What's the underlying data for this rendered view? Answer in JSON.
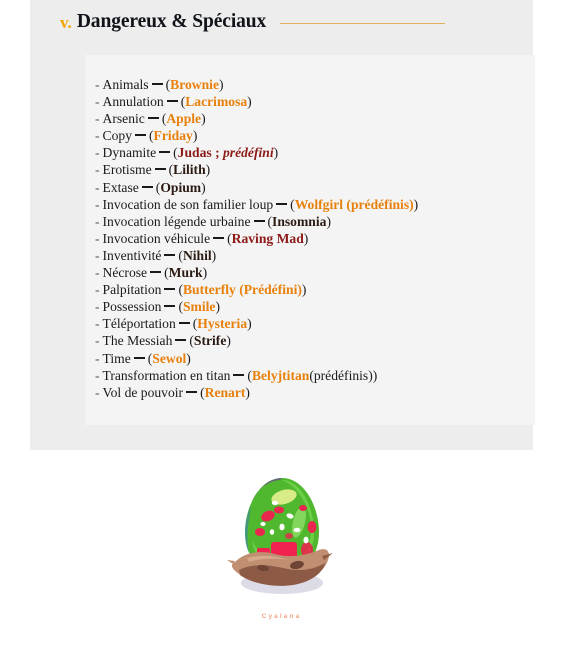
{
  "section": {
    "numeral": "v.",
    "title": "Dangereux & Spéciaux",
    "rule_color": "#e0b05c"
  },
  "colors": {
    "orange": "#e8800c",
    "dark": "#2b1a12",
    "red": "#8c1a17",
    "container_bg": "#ededed",
    "panel_bg": "#f4f4f4",
    "page_bg": "#ffffff",
    "caption": "#f0a386"
  },
  "list": {
    "items": [
      {
        "label": "Animals",
        "name": "Brownie",
        "style": "orange",
        "suffix": "",
        "suffix_style": ""
      },
      {
        "label": "Annulation",
        "name": "Lacrimosa",
        "style": "orange",
        "suffix": "",
        "suffix_style": ""
      },
      {
        "label": "Arsenic",
        "name": "Apple",
        "style": "orange",
        "suffix": "",
        "suffix_style": ""
      },
      {
        "label": "Copy",
        "name": "Friday",
        "style": "orange",
        "suffix": "",
        "suffix_style": ""
      },
      {
        "label": "Dynamite",
        "name": "Judas ;",
        "style": "red",
        "suffix": " prédéfini",
        "suffix_style": "italic"
      },
      {
        "label": "Erotisme",
        "name": "Lilith",
        "style": "dark",
        "suffix": "",
        "suffix_style": ""
      },
      {
        "label": "Extase",
        "name": "Opium",
        "style": "dark",
        "suffix": "",
        "suffix_style": ""
      },
      {
        "label": "Invocation de son familier loup",
        "name": "Wolfgirl (prédéfinis)",
        "style": "orange",
        "suffix": "",
        "suffix_style": ""
      },
      {
        "label": "Invocation légende urbaine",
        "name": "Insomnia",
        "style": "dark",
        "suffix": "",
        "suffix_style": ""
      },
      {
        "label": "Invocation véhicule",
        "name": "Raving Mad",
        "style": "red",
        "suffix": "",
        "suffix_style": ""
      },
      {
        "label": "Inventivité",
        "name": "Nihil",
        "style": "dark",
        "suffix": "",
        "suffix_style": ""
      },
      {
        "label": "Nécrose",
        "name": "Murk",
        "style": "dark",
        "suffix": "",
        "suffix_style": ""
      },
      {
        "label": "Palpitation",
        "name": "Butterfly (Prédéfini)",
        "style": "orange",
        "suffix": "",
        "suffix_style": ""
      },
      {
        "label": "Possession",
        "name": "Smile",
        "style": "orange",
        "suffix": "",
        "suffix_style": ""
      },
      {
        "label": "Téléportation",
        "name": "Hysteria",
        "style": "orange",
        "suffix": "",
        "suffix_style": ""
      },
      {
        "label": "The Messiah",
        "name": "Strife",
        "style": "dark",
        "suffix": "",
        "suffix_style": ""
      },
      {
        "label": "Time",
        "name": "Sewol",
        "style": "orange",
        "suffix": "",
        "suffix_style": ""
      },
      {
        "label": "Transformation en titan",
        "name": "Belyjtitan",
        "style": "orange",
        "suffix": "(prédéfinis)",
        "suffix_style": "plain"
      },
      {
        "label": "Vol de pouvoir",
        "name": "Renart",
        "style": "orange",
        "suffix": "",
        "suffix_style": ""
      }
    ]
  },
  "illustration": {
    "subject": "green-speckled-egg-in-nest",
    "caption": "Cyalana"
  }
}
